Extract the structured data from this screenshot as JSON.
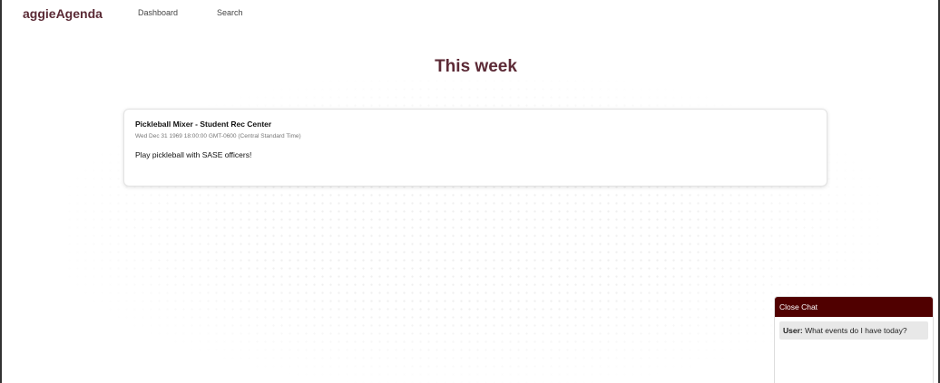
{
  "nav": {
    "brand": "aggieAgenda",
    "links": [
      {
        "label": "Dashboard"
      },
      {
        "label": "Search"
      }
    ]
  },
  "main": {
    "title": "This week",
    "events": [
      {
        "title": "Pickleball Mixer - Student Rec Center",
        "date": "Wed Dec 31 1969 18:00:00 GMT-0600 (Central Standard Time)",
        "description": "Play pickleball with SASE officers!"
      }
    ]
  },
  "chat": {
    "close_label": "Close Chat",
    "messages": [
      {
        "sender": "User:",
        "text": " What events do I have today?"
      }
    ]
  },
  "colors": {
    "brand": "#5a2a35",
    "title": "#5c2a36",
    "chat_header": "#500000"
  }
}
